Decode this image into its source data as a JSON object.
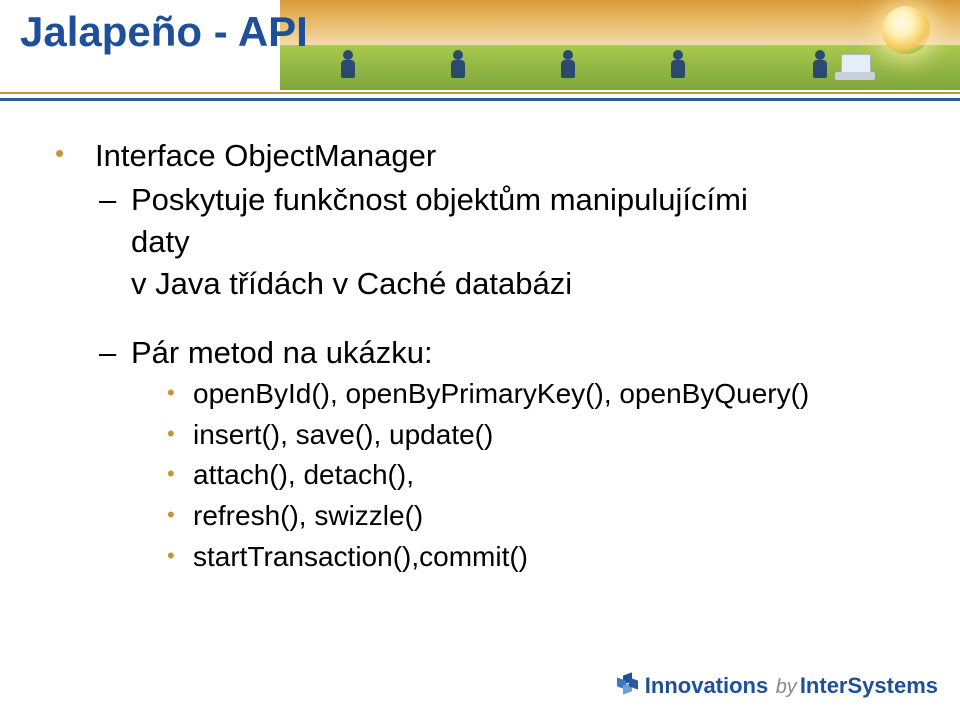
{
  "title": "Jalapeño - API",
  "bullets": {
    "l1": "Interface ObjectManager",
    "l2a": "Poskytuje funkčnost objektům manipulujícími daty",
    "l2a_line1": "Poskytuje funkčnost objektům manipulujícími",
    "l2a_line2": "daty",
    "l2b": "v Java třídách v Caché databázi",
    "l2c": "Pár metod na ukázku:",
    "l3a": "openById(), openByPrimaryKey(), openByQuery()",
    "l3b": "insert(), save(), update()",
    "l3c": "attach(), detach(),",
    "l3d": "refresh(), swizzle()",
    "l3e": "startTransaction(),commit()"
  },
  "footer": {
    "word1": "Innovations",
    "word2": "by",
    "word3": "InterSystems"
  }
}
